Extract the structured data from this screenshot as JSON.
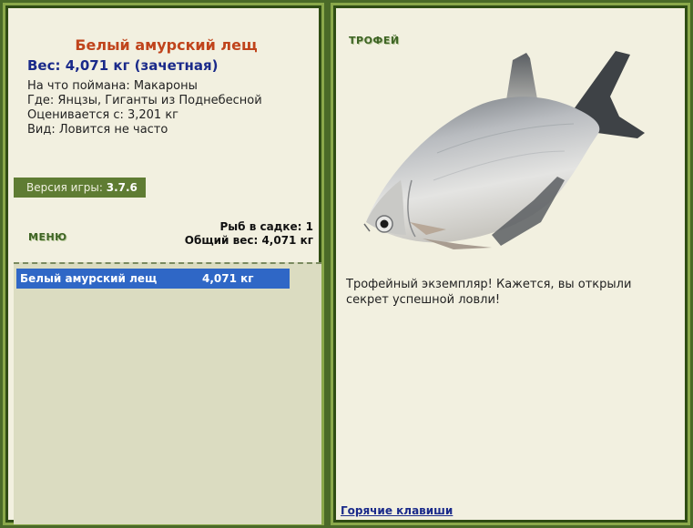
{
  "fish": {
    "title": "Белый амурский лещ",
    "weight_line": "Вес: 4,071 кг (зачетная)",
    "bait_line": "На что поймана: Макароны",
    "location_line": "Где: Янцзы, Гиганты из Поднебесной",
    "value_line": "Оценивается с: 3,201 кг",
    "rarity_line": "Вид: Ловится не часто"
  },
  "version": {
    "label": "Версия игры: ",
    "value": "3.7.6"
  },
  "menu": {
    "label": "МЕНЮ"
  },
  "stats": {
    "count_line": "Рыб в садке: 1",
    "total_line": "Общий вес: 4,071 кг"
  },
  "cage": {
    "rows": [
      {
        "name": "Белый амурский лещ",
        "weight": "4,071 кг"
      }
    ]
  },
  "trophy": {
    "label": "ТРОФЕЙ",
    "description": "Трофейный экземпляр! Кажется, вы открыли секрет успешной ловли!",
    "image_icon": "bream-fish-image"
  },
  "footer": {
    "hotkeys_label": "Горячие клавиши"
  },
  "colors": {
    "title": "#c0441c",
    "weight": "#1a2a8a",
    "selection": "#2f67c6",
    "frame": "#4a6a28"
  }
}
